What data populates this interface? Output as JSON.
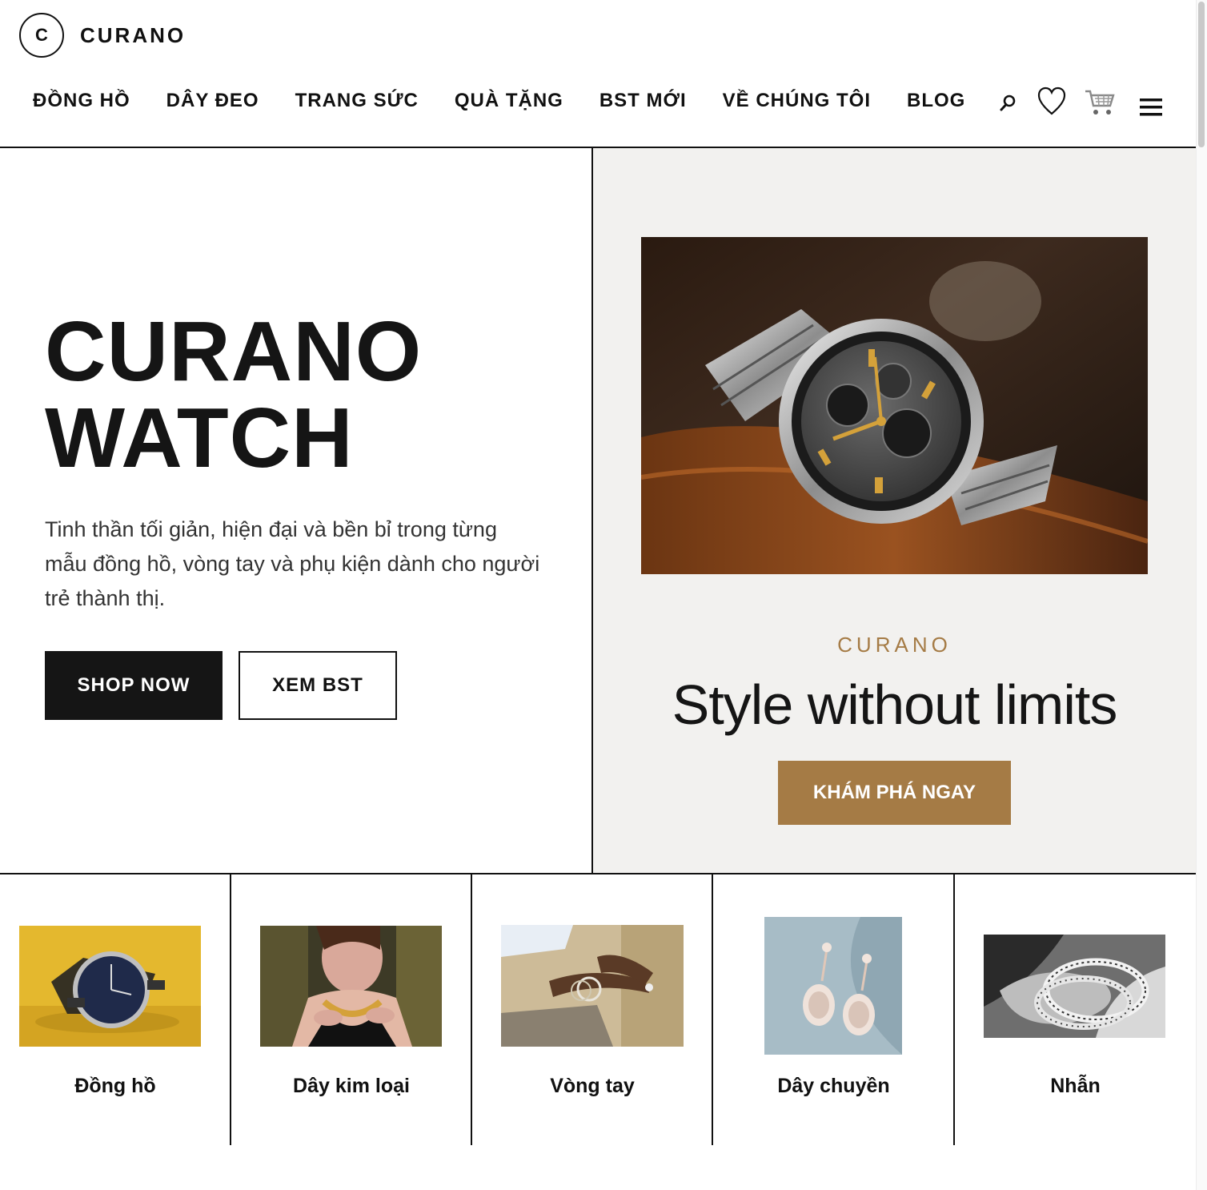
{
  "brand": {
    "mark": "C",
    "name": "CURANO"
  },
  "nav": {
    "items": [
      "ĐỒNG HỒ",
      "DÂY ĐEO",
      "TRANG SỨC",
      "QUÀ TẶNG",
      "BST MỚI",
      "VỀ CHÚNG TÔI",
      "BLOG"
    ],
    "icons": [
      "search-icon",
      "heart-icon",
      "cart-icon",
      "menu-icon"
    ]
  },
  "hero": {
    "title_line1": "CURANO",
    "title_line2": "WATCH",
    "description": "Tinh thần tối giản, hiện đại và bền bỉ trong từng mẫu đồng hồ, vòng tay và phụ kiện dành cho người trẻ thành thị.",
    "primary_button": "SHOP NOW",
    "secondary_button": "XEM BST"
  },
  "feature": {
    "kicker": "CURANO",
    "tagline": "Style without limits",
    "button": "KHÁM PHÁ NGAY"
  },
  "categories": [
    {
      "label": "Đồng hồ"
    },
    {
      "label": "Dây kim loại"
    },
    {
      "label": "Vòng tay"
    },
    {
      "label": "Dây chuyền"
    },
    {
      "label": "Nhẫn"
    }
  ],
  "colors": {
    "accent": "#a57b45",
    "dark": "#151515",
    "panel": "#f2f1ef"
  }
}
